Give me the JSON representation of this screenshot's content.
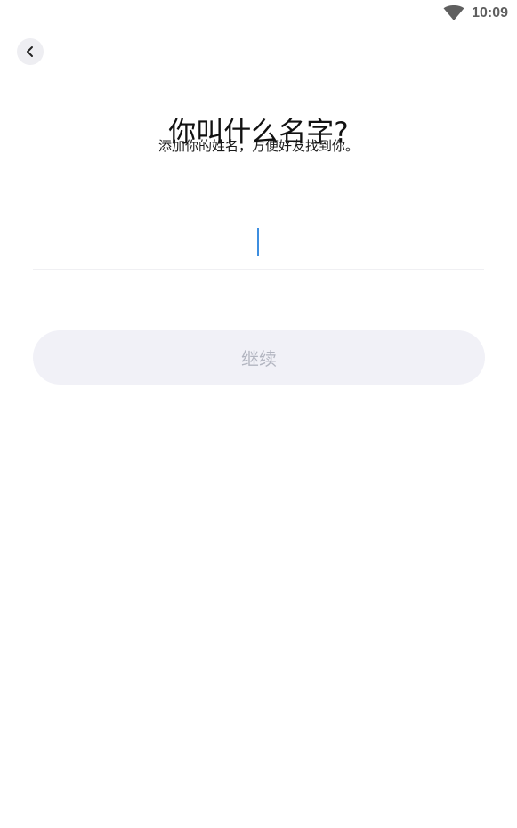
{
  "status_bar": {
    "time": "10:09",
    "wifi_icon": "wifi-icon"
  },
  "header": {
    "back_icon": "chevron-left-icon"
  },
  "main": {
    "title": "你叫什么名字?",
    "subtitle": "添加你的姓名，方便好友找到你。",
    "name_field": {
      "value": "",
      "placeholder": ""
    },
    "continue_label": "继续"
  },
  "colors": {
    "cursor": "#3d8ee0",
    "button_bg": "#f1f1f7",
    "button_text_disabled": "#b2b5c0",
    "back_button_bg": "#eeeef2"
  }
}
